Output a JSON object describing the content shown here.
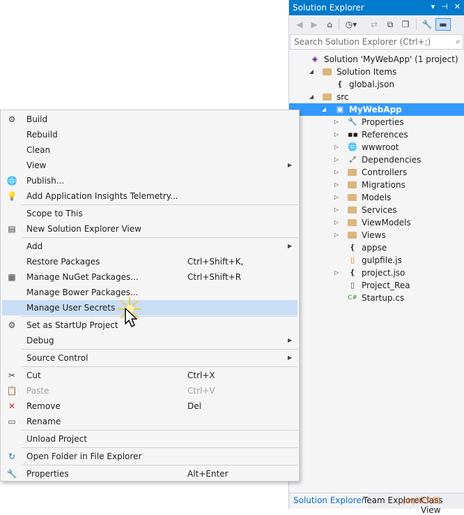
{
  "solution_explorer": {
    "title": "Solution Explorer",
    "title_controls": [
      "▾",
      "⊣",
      "✕"
    ],
    "search_placeholder": "Search Solution Explorer (Ctrl+;)",
    "toolbar_icons": [
      "back-icon",
      "forward-icon",
      "home-icon",
      "history-icon",
      "sync-icon",
      "collapse-icon",
      "show-all-icon",
      "properties-icon",
      "preview-icon"
    ],
    "tree": [
      {
        "label": "Solution 'MyWebApp' (1 project)",
        "icon": "solution-icon",
        "arrow": "",
        "level": 0
      },
      {
        "label": "Solution Items",
        "icon": "folder-icon",
        "arrow": "◢",
        "level": 1
      },
      {
        "label": "global.json",
        "icon": "json-file-icon",
        "arrow": "",
        "level": 2
      },
      {
        "label": "src",
        "icon": "folder-icon",
        "arrow": "◢",
        "level": 1
      },
      {
        "label": "MyWebApp",
        "icon": "web-project-icon",
        "arrow": "◢",
        "level": 2,
        "selected": true
      },
      {
        "label": "Properties",
        "icon": "wrench-icon",
        "arrow": "▷",
        "level": 3
      },
      {
        "label": "References",
        "icon": "references-icon",
        "arrow": "▷",
        "level": 3
      },
      {
        "label": "wwwroot",
        "icon": "globe-icon",
        "arrow": "▷",
        "level": 3
      },
      {
        "label": "Dependencies",
        "icon": "dependencies-icon",
        "arrow": "▷",
        "level": 3
      },
      {
        "label": "Controllers",
        "icon": "folder-icon",
        "arrow": "▷",
        "level": 3
      },
      {
        "label": "Migrations",
        "icon": "folder-icon",
        "arrow": "▷",
        "level": 3
      },
      {
        "label": "Models",
        "icon": "folder-icon",
        "arrow": "▷",
        "level": 3
      },
      {
        "label": "Services",
        "icon": "folder-icon",
        "arrow": "▷",
        "level": 3
      },
      {
        "label": "ViewModels",
        "icon": "folder-icon",
        "arrow": "▷",
        "level": 3
      },
      {
        "label": "Views",
        "icon": "folder-icon",
        "arrow": "▷",
        "level": 3
      },
      {
        "label": "appse",
        "icon": "json-file-icon",
        "arrow": "",
        "level": 3
      },
      {
        "label": "gulpfile.js",
        "icon": "js-file-icon",
        "arrow": "",
        "level": 3
      },
      {
        "label": "project.jso",
        "icon": "json-file-icon",
        "arrow": "▷",
        "level": 3
      },
      {
        "label": "Project_Rea",
        "icon": "readme-file-icon",
        "arrow": "",
        "level": 3
      },
      {
        "label": "Startup.cs",
        "icon": "csharp-file-icon",
        "arrow": "",
        "level": 3
      }
    ],
    "tabs": [
      "Solution Explorer",
      "Team Explorer",
      "Class View"
    ],
    "watermark": "php中文网"
  },
  "context_menu": {
    "items": [
      {
        "label": "Build",
        "icon": "build-icon",
        "shortcut": "",
        "submenu": false
      },
      {
        "label": "Rebuild",
        "icon": "",
        "shortcut": "",
        "submenu": false
      },
      {
        "label": "Clean",
        "icon": "",
        "shortcut": "",
        "submenu": false
      },
      {
        "label": "View",
        "icon": "",
        "shortcut": "",
        "submenu": true
      },
      {
        "label": "Publish...",
        "icon": "publish-icon",
        "shortcut": "",
        "submenu": false
      },
      {
        "label": "Add Application Insights Telemetry...",
        "icon": "insights-icon",
        "shortcut": "",
        "submenu": false
      },
      {
        "sep": true
      },
      {
        "label": "Scope to This",
        "icon": "",
        "shortcut": "",
        "submenu": false
      },
      {
        "label": "New Solution Explorer View",
        "icon": "new-view-icon",
        "shortcut": "",
        "submenu": false
      },
      {
        "sep": true
      },
      {
        "label": "Add",
        "icon": "",
        "shortcut": "",
        "submenu": true
      },
      {
        "label": "Restore Packages",
        "icon": "",
        "shortcut": "Ctrl+Shift+K, Ctrl+Shift+R",
        "submenu": false
      },
      {
        "label": "Manage NuGet Packages...",
        "icon": "nuget-icon",
        "shortcut": "",
        "submenu": false
      },
      {
        "label": "Manage Bower Packages...",
        "icon": "",
        "shortcut": "",
        "submenu": false
      },
      {
        "label": "Manage User Secrets",
        "icon": "",
        "shortcut": "",
        "submenu": false,
        "highlighted": true
      },
      {
        "sep": true
      },
      {
        "label": "Set as StartUp Project",
        "icon": "gear-icon",
        "shortcut": "",
        "submenu": false
      },
      {
        "label": "Debug",
        "icon": "",
        "shortcut": "",
        "submenu": true
      },
      {
        "sep": true
      },
      {
        "label": "Source Control",
        "icon": "",
        "shortcut": "",
        "submenu": true
      },
      {
        "sep": true
      },
      {
        "label": "Cut",
        "icon": "scissors-icon",
        "shortcut": "Ctrl+X",
        "submenu": false
      },
      {
        "label": "Paste",
        "icon": "paste-icon",
        "shortcut": "Ctrl+V",
        "submenu": false,
        "disabled": true
      },
      {
        "label": "Remove",
        "icon": "remove-icon",
        "shortcut": "Del",
        "submenu": false
      },
      {
        "label": "Rename",
        "icon": "rename-icon",
        "shortcut": "",
        "submenu": false
      },
      {
        "sep": true
      },
      {
        "label": "Unload Project",
        "icon": "",
        "shortcut": "",
        "submenu": false
      },
      {
        "sep": true
      },
      {
        "label": "Open Folder in File Explorer",
        "icon": "refresh-folder-icon",
        "shortcut": "",
        "submenu": false
      },
      {
        "sep": true
      },
      {
        "label": "Properties",
        "icon": "wrench-icon",
        "shortcut": "Alt+Enter",
        "submenu": false
      }
    ]
  },
  "colors": {
    "accent": "#007acc",
    "selection": "#3399ff",
    "menu_highlight": "#c9def5",
    "folder": "#dcb67a"
  }
}
